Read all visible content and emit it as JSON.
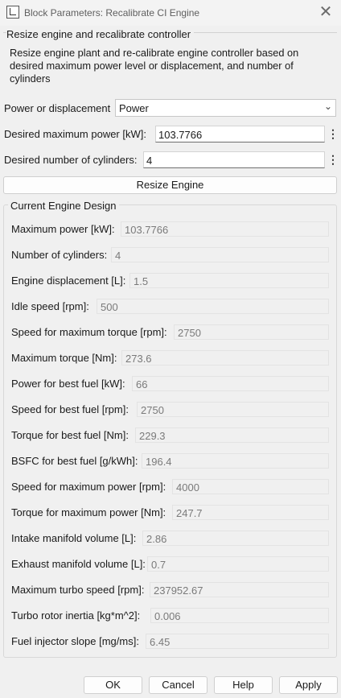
{
  "window": {
    "title": "Block Parameters: Recalibrate CI Engine"
  },
  "resize_group": {
    "title": "Resize engine and recalibrate controller",
    "description": "Resize engine plant and re-calibrate engine controller based on desired maximum power level or displacement, and number of cylinders"
  },
  "power_or_displacement": {
    "label": "Power or displacement",
    "value": "Power"
  },
  "desired_power": {
    "label": "Desired maximum power [kW]:",
    "value": "103.7766"
  },
  "desired_cylinders": {
    "label": "Desired number of cylinders:",
    "value": "4"
  },
  "resize_button": "Resize Engine",
  "current_design": {
    "title": "Current Engine Design",
    "fields": [
      {
        "label": "Maximum power [kW]:",
        "value": "103.7766"
      },
      {
        "label": "Number of cylinders:",
        "value": "4"
      },
      {
        "label": "Engine displacement [L]:",
        "value": "1.5"
      },
      {
        "label": "Idle speed [rpm]:",
        "value": "500"
      },
      {
        "label": "Speed for maximum torque [rpm]:",
        "value": "2750"
      },
      {
        "label": "Maximum torque [Nm]:",
        "value": "273.6"
      },
      {
        "label": "Power for best fuel [kW]:",
        "value": "66"
      },
      {
        "label": "Speed for best fuel [rpm]:",
        "value": "2750"
      },
      {
        "label": "Torque for best fuel [Nm]:",
        "value": "229.3"
      },
      {
        "label": "BSFC for best fuel [g/kWh]:",
        "value": "196.4"
      },
      {
        "label": "Speed for maximum power [rpm]:",
        "value": "4000"
      },
      {
        "label": "Torque for maximum power [Nm]:",
        "value": "247.7"
      },
      {
        "label": "Intake manifold volume [L]:",
        "value": "2.86"
      },
      {
        "label": "Exhaust manifold volume [L]:",
        "value": "0.7"
      },
      {
        "label": "Maximum turbo speed [rpm]:",
        "value": "237952.67"
      },
      {
        "label": "Turbo rotor inertia [kg*m^2]:",
        "value": "0.006"
      },
      {
        "label": "Fuel injector slope [mg/ms]:",
        "value": "6.45"
      }
    ]
  },
  "buttons": {
    "ok": "OK",
    "cancel": "Cancel",
    "help": "Help",
    "apply": "Apply"
  },
  "icons": {
    "app": "block-parameters-icon",
    "close": "close-icon",
    "dropdown": "chevron-down-icon",
    "more": "kebab-menu-icon"
  },
  "colors": {
    "window_bg": "#f0f0f0",
    "field_text_disabled": "#7a7a7a"
  }
}
